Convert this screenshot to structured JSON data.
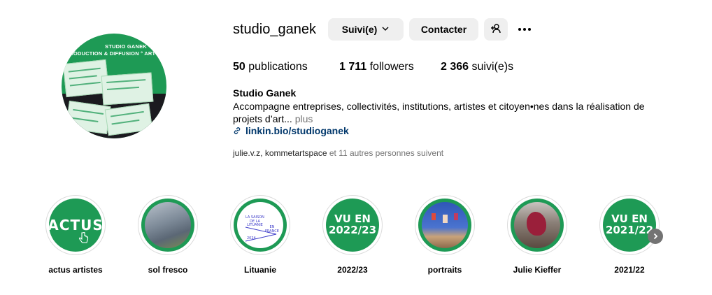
{
  "profile": {
    "username": "studio_ganek",
    "avatar_text_line1": "STUDIO GANEK",
    "avatar_text_line2": "PRODUCTION & DIFFUSION ° ART CONT"
  },
  "actions": {
    "follow_label": "Suivi(e)",
    "contact_label": "Contacter",
    "add_user_icon": "person-add-icon",
    "more_icon": "more-options-icon"
  },
  "stats": {
    "posts_count": "50",
    "posts_label": "publications",
    "followers_count": "1 711",
    "followers_label": "followers",
    "following_count": "2 366",
    "following_label": "suivi(e)s"
  },
  "bio": {
    "name": "Studio Ganek",
    "text": "Accompagne entreprises, collectivités, institutions, artistes et citoyen•nes dans la réalisation de projets d’art...",
    "more": "plus",
    "link": "linkin.bio/studioganek"
  },
  "followed_by": {
    "user1": "julie.v.z",
    "separator": ",",
    "user2": "kommetartspace",
    "others": "et 11 autres personnes suivent"
  },
  "highlights": [
    {
      "label": "actus artistes",
      "cover_text": "ACTUS"
    },
    {
      "label": "sol fresco"
    },
    {
      "label": "Lituanie",
      "cover_lines": [
        "LA SAISON",
        "DE LA",
        "LITUANIE",
        "EN",
        "FRANCE",
        "2024"
      ]
    },
    {
      "label": "2022/23",
      "cover_line1": "VU EN",
      "cover_line2": "2022/23"
    },
    {
      "label": "portraits"
    },
    {
      "label": "Julie Kieffer"
    },
    {
      "label": "2021/22",
      "cover_line1": "VU EN",
      "cover_line2": "2021/22"
    }
  ],
  "colors": {
    "brand_green": "#1e9a55",
    "button_bg": "#efefef",
    "link_blue": "#00376b",
    "muted": "#737373"
  }
}
